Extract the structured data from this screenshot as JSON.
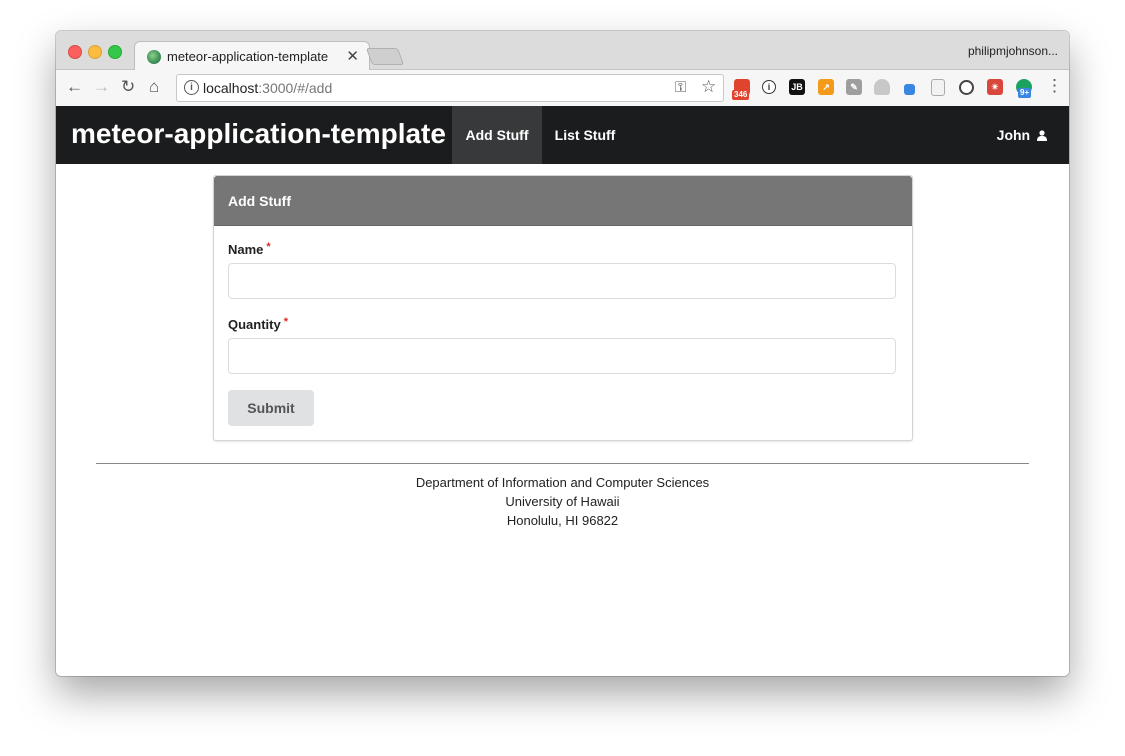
{
  "browser": {
    "tab_title": "meteor-application-template",
    "tab_close": "✕",
    "profile_name": "philipmjohnson...",
    "url_host": "localhost",
    "url_path": ":3000/#/add",
    "extension_badges": [
      "346",
      "JB",
      "9+"
    ]
  },
  "navbar": {
    "brand": "meteor-application-template",
    "links": [
      {
        "label": "Add Stuff",
        "active": true
      },
      {
        "label": "List Stuff",
        "active": false
      }
    ],
    "user": "John"
  },
  "form": {
    "title": "Add Stuff",
    "fields": [
      {
        "label": "Name",
        "required_mark": "*",
        "value": ""
      },
      {
        "label": "Quantity",
        "required_mark": "*",
        "value": ""
      }
    ],
    "submit_label": "Submit"
  },
  "footer": {
    "line1": "Department of Information and Computer Sciences",
    "line2": "University of Hawaii",
    "line3": "Honolulu, HI 96822"
  },
  "colors": {
    "navbar_bg": "#1b1c1d",
    "active_link_bg": "#38393a",
    "card_header_bg": "#767676",
    "required_star": "#db2828",
    "submit_bg": "#e0e1e2"
  }
}
